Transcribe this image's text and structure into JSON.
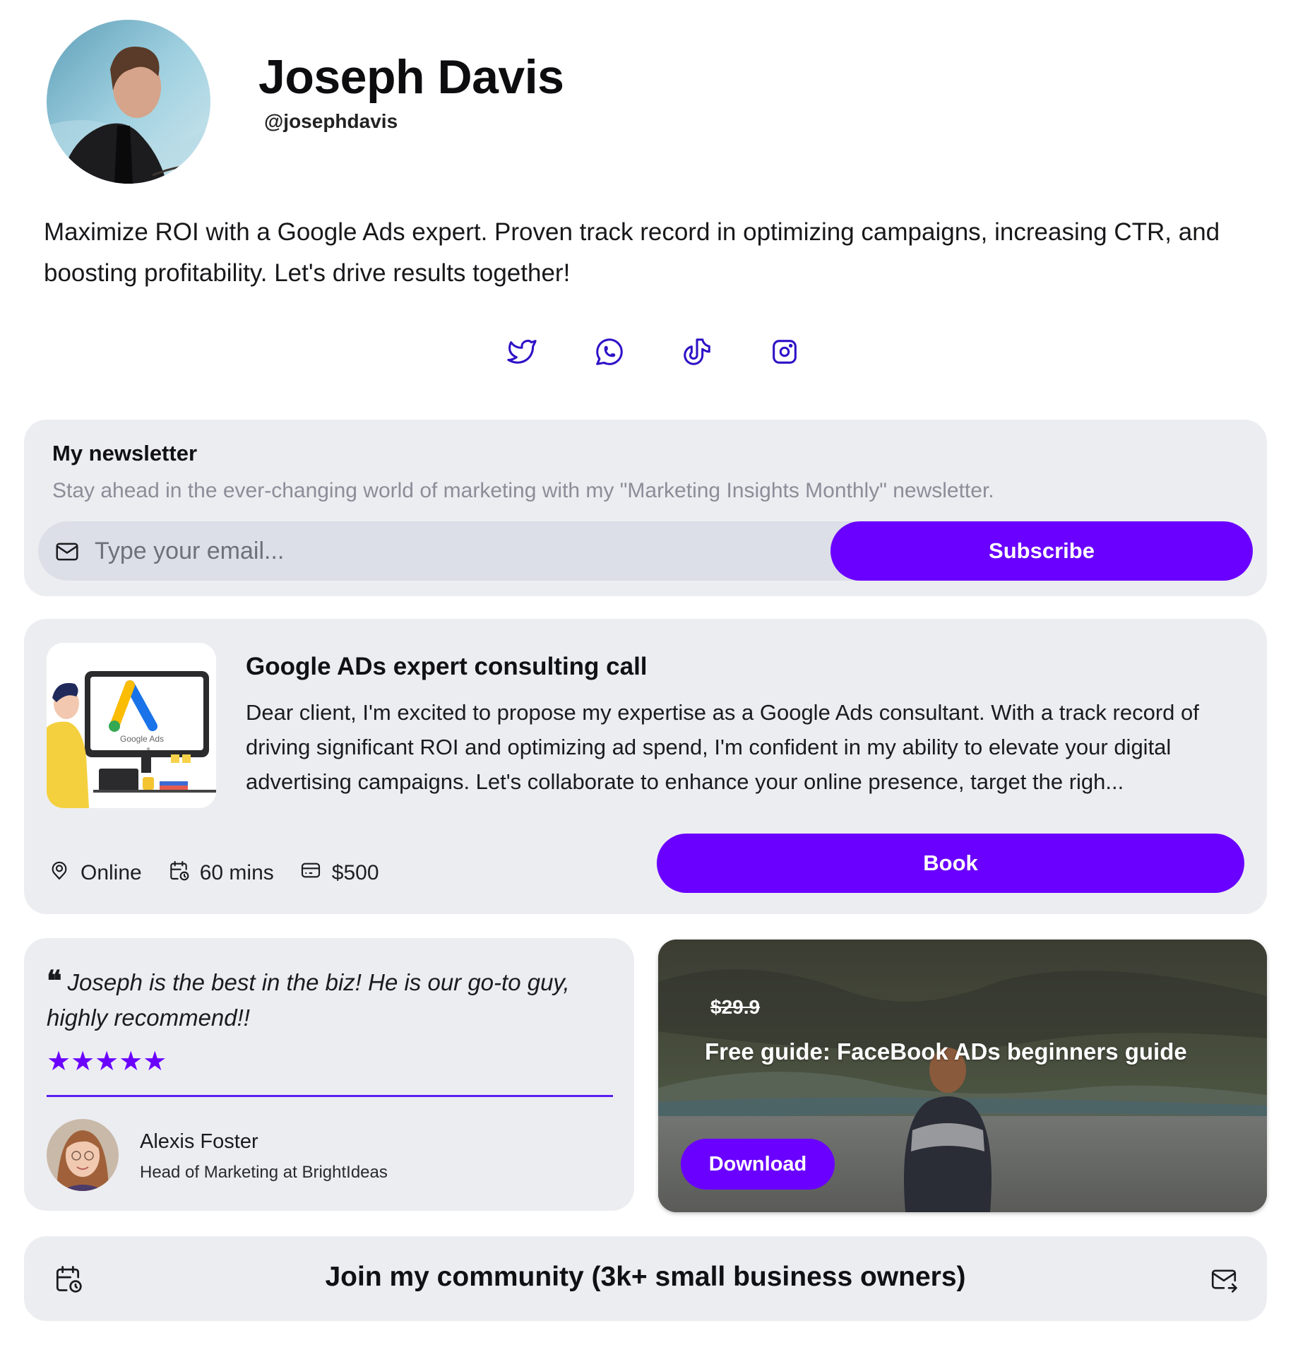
{
  "profile": {
    "name": "Joseph Davis",
    "handle": "@josephdavis",
    "bio": "Maximize ROI with a Google Ads expert. Proven track record in optimizing campaigns, increasing CTR, and boosting profitability. Let's drive results together!"
  },
  "socials": [
    {
      "icon": "twitter-icon"
    },
    {
      "icon": "whatsapp-icon"
    },
    {
      "icon": "tiktok-icon"
    },
    {
      "icon": "instagram-icon"
    }
  ],
  "newsletter": {
    "title": "My newsletter",
    "description": "Stay ahead in the ever-changing world of marketing with my \"Marketing Insights Monthly\" newsletter.",
    "placeholder": "Type your email...",
    "button": "Subscribe"
  },
  "consulting": {
    "image_label": "Google Ads",
    "title": "Google ADs expert consulting call",
    "description": "Dear client, I'm excited to propose my expertise as a Google Ads consultant. With a track record of driving significant ROI and optimizing ad spend, I'm confident in my ability to elevate your digital advertising campaigns. Let's collaborate to enhance your online presence, target the righ...",
    "location": "Online",
    "duration": "60 mins",
    "price": "$500",
    "button": "Book"
  },
  "testimonial": {
    "quote": "Joseph is the best in the biz! He is our go-to guy, highly recommend!!",
    "rating": 5,
    "stars": "★★★★★",
    "name": "Alexis Foster",
    "role": "Head of Marketing at BrightIdeas"
  },
  "guide": {
    "old_price": "$29.9",
    "title": "Free guide: FaceBook ADs beginners guide",
    "button": "Download"
  },
  "community": {
    "title": "Join my community (3k+ small business owners)"
  },
  "colors": {
    "accent": "#6a00ff",
    "card_bg": "#ecedf1",
    "icon": "#2d12c7"
  }
}
